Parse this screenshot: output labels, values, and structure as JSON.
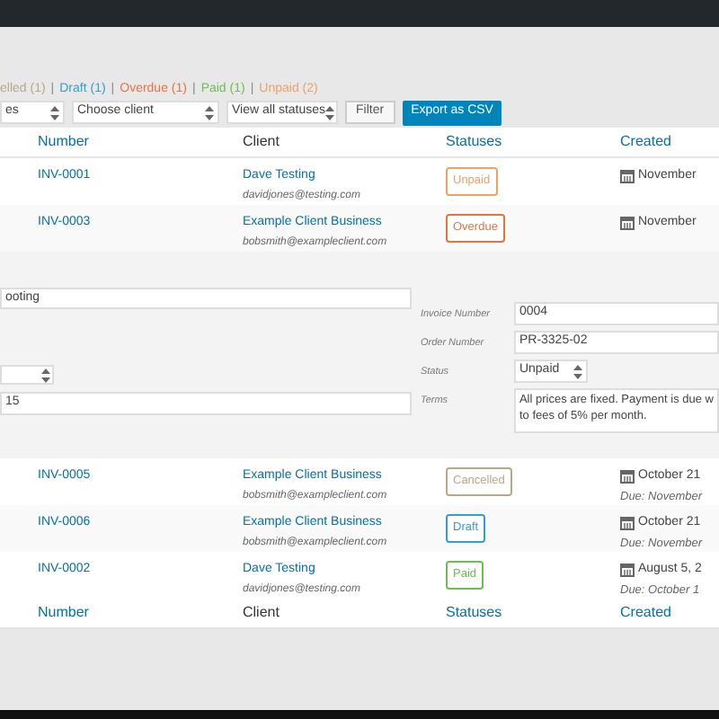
{
  "filter_separator": "|",
  "status_filters": [
    {
      "label": "elled",
      "count": "(1)",
      "color": "#b8a888"
    },
    {
      "label": "Draft",
      "count": "(1)",
      "color": "#2ea2cc"
    },
    {
      "label": "Overdue",
      "count": "(1)",
      "color": "#e8743b"
    },
    {
      "label": "Paid",
      "count": "(1)",
      "color": "#6bbf4e"
    },
    {
      "label": "Unpaid",
      "count": "(2)",
      "color": "#f0a060"
    }
  ],
  "filters": {
    "select_1": "es",
    "client_select": "Choose client",
    "status_select": "View all statuses",
    "filter_button": "Filter",
    "export_button": "Export as CSV"
  },
  "table": {
    "columns": [
      "Number",
      "Client",
      "Statuses",
      "Created"
    ],
    "rows_top": [
      {
        "number": "INV-0001",
        "client": "Dave Testing",
        "email": "davidjones@testing.com",
        "status": "Unpaid",
        "color": "#f0a060",
        "created": "November"
      },
      {
        "number": "INV-0003",
        "client": "Example Client Business",
        "email": "bobsmith@exampleclient.com",
        "status": "Overdue",
        "color": "#e8743b",
        "created": "November"
      }
    ],
    "rows_bottom": [
      {
        "number": "INV-0005",
        "client": "Example Client Business",
        "email": "bobsmith@exampleclient.com",
        "status": "Cancelled",
        "color": "#b8a888",
        "created": "October 21",
        "due": "Due: November"
      },
      {
        "number": "INV-0006",
        "client": "Example Client Business",
        "email": "bobsmith@exampleclient.com",
        "status": "Draft",
        "color": "#2ea2cc",
        "created": "October 21",
        "due": "Due: November"
      },
      {
        "number": "INV-0002",
        "client": "Dave Testing",
        "email": "davidjones@testing.com",
        "status": "Paid",
        "color": "#6bbf4e",
        "created": "August 5, 2",
        "due": "Due: October 1"
      }
    ],
    "footer_columns": [
      "Number",
      "Client",
      "Statuses",
      "Created"
    ]
  },
  "edit_panel": {
    "title_value": "ooting",
    "date_value": "15",
    "fields": [
      {
        "label": "Invoice Number",
        "value": "0004",
        "kind": "input"
      },
      {
        "label": "Order Number",
        "value": "PR-3325-02",
        "kind": "input"
      },
      {
        "label": "Status",
        "value": "Unpaid",
        "kind": "select"
      },
      {
        "label": "Terms",
        "value": "All prices are fixed. Payment is due w\nto fees of 5% per month.",
        "kind": "textarea"
      }
    ]
  }
}
